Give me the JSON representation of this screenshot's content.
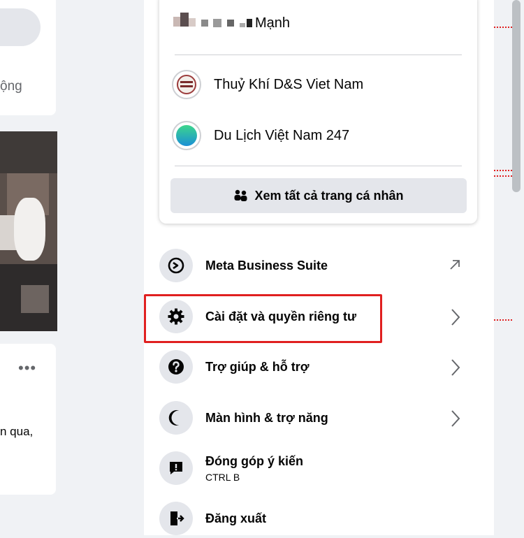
{
  "left_feed": {
    "partial_text_1": "ộng",
    "more_label": "•••",
    "partial_text_2": "n qua,"
  },
  "profiles": [
    {
      "name": "Mạnh",
      "avatar_icon": "pixelated-avatar-icon"
    },
    {
      "name": "Thuỷ Khí D&S Viet Nam",
      "avatar_icon": "company-logo-icon"
    },
    {
      "name": "Du Lịch Việt Nam 247",
      "avatar_icon": "travel-logo-icon"
    }
  ],
  "see_all_label": "Xem tất cả trang cá nhân",
  "menu_items": [
    {
      "label": "Meta Business Suite",
      "icon": "meta-business-suite-icon",
      "trailing": "external-arrow-icon"
    },
    {
      "label": "Cài đặt và quyền riêng tư",
      "icon": "gear-icon",
      "trailing": "chevron-right-icon"
    },
    {
      "label": "Trợ giúp & hỗ trợ",
      "icon": "help-icon",
      "trailing": "chevron-right-icon"
    },
    {
      "label": "Màn hình & trợ năng",
      "icon": "moon-icon",
      "trailing": "chevron-right-icon"
    },
    {
      "label": "Đóng góp ý kiến",
      "sub": "CTRL B",
      "icon": "feedback-icon",
      "trailing": ""
    },
    {
      "label": "Đăng xuất",
      "icon": "logout-icon",
      "trailing": ""
    }
  ],
  "colors": {
    "highlight": "#e02020",
    "icon_bg": "#e4e6eb",
    "page_bg": "#f0f2f5"
  }
}
